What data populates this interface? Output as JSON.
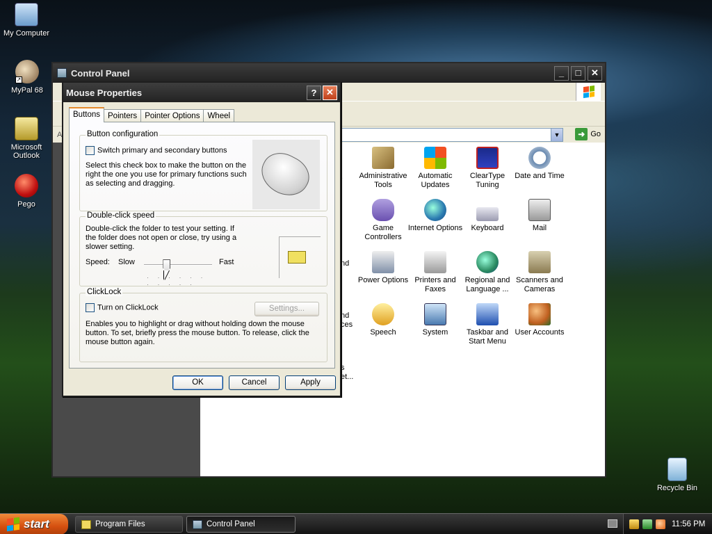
{
  "desktop": {
    "icons": [
      {
        "label": "My Computer"
      },
      {
        "label": "MyPal 68"
      },
      {
        "label": "Microsoft Outlook"
      },
      {
        "label": "Pego"
      },
      {
        "label": "Recycle Bin"
      }
    ]
  },
  "control_panel": {
    "title": "Control Panel",
    "address_label": "A",
    "go_label": "Go",
    "items": [
      {
        "label": "Administrative Tools"
      },
      {
        "label": "Automatic Updates"
      },
      {
        "label": "ClearType Tuning"
      },
      {
        "label": "Date and Time"
      },
      {
        "label": "Game Controllers"
      },
      {
        "label": "Internet Options"
      },
      {
        "label": "Keyboard"
      },
      {
        "label": "Mail"
      },
      {
        "label": "Power Options"
      },
      {
        "label": "Printers and Faxes"
      },
      {
        "label": "Regional and Language ..."
      },
      {
        "label": "Scanners and Cameras"
      },
      {
        "label": "Speech"
      },
      {
        "label": "System"
      },
      {
        "label": "Taskbar and Start Menu"
      },
      {
        "label": "User Accounts"
      }
    ],
    "partial_labels": [
      ".",
      "nd",
      "nd",
      "ces",
      "s",
      "et..."
    ]
  },
  "mouse_properties": {
    "title": "Mouse Properties",
    "help_label": "?",
    "close_label": "✕",
    "tabs": [
      "Buttons",
      "Pointers",
      "Pointer Options",
      "Wheel"
    ],
    "button_config": {
      "title": "Button configuration",
      "checkbox_label": "Switch primary and secondary buttons",
      "checked": false,
      "description": "Select this check box to make the button on the right the one you use for primary functions such as selecting and dragging."
    },
    "double_click": {
      "title": "Double-click speed",
      "description": "Double-click the folder to test your setting. If the folder does not open or close, try using a slower setting.",
      "speed_label": "Speed:",
      "slow_label": "Slow",
      "fast_label": "Fast",
      "speed_position": 0.33
    },
    "clicklock": {
      "title": "ClickLock",
      "checkbox_label": "Turn on ClickLock",
      "checked": false,
      "settings_label": "Settings...",
      "description": "Enables you to highlight or drag without holding down the mouse button. To set, briefly press the mouse button. To release, click the mouse button again."
    },
    "buttons": {
      "ok": "OK",
      "cancel": "Cancel",
      "apply": "Apply"
    }
  },
  "taskbar": {
    "start_label": "start",
    "tasks": [
      {
        "label": "Program Files"
      },
      {
        "label": "Control Panel"
      }
    ],
    "clock": "11:56 PM"
  },
  "colors": {
    "xp_flag_red": "#f25022",
    "xp_flag_green": "#7fba00",
    "xp_flag_blue": "#00a4ef",
    "xp_flag_yellow": "#ffb900"
  }
}
